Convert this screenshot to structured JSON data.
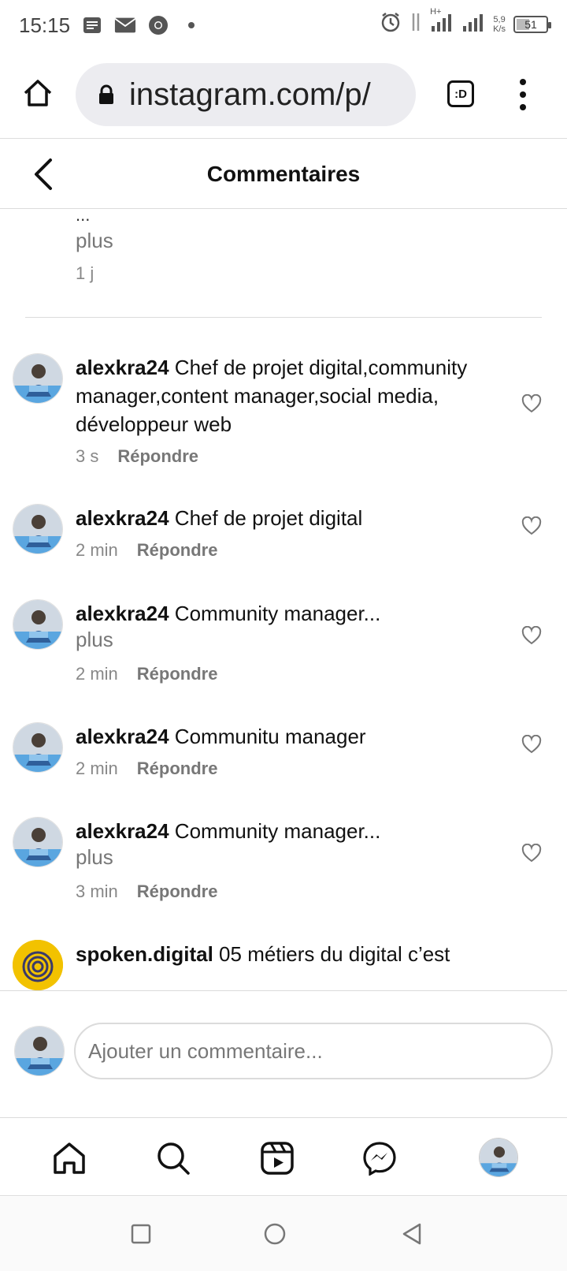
{
  "status_bar": {
    "time": "15:15",
    "net_speed_value": "5,9",
    "net_speed_unit": "K/s",
    "network_type": "H+",
    "battery": "51",
    "left_icons": [
      "notes-icon",
      "mail-icon",
      "chrome-icon",
      "dot-icon"
    ],
    "right_icons": [
      "alarm-icon",
      "data-arrows-icon",
      "signal-icon",
      "signal-icon"
    ]
  },
  "browser": {
    "url": "instagram.com/p/",
    "tab_icon_label": ":D"
  },
  "header": {
    "title": "Commentaires"
  },
  "previous_comment": {
    "ellipsis": "...",
    "more": "plus",
    "time": "1 j"
  },
  "comments": [
    {
      "user": "alexkra24",
      "text": "Chef de projet digital,community manager,content manager,social media, développeur web",
      "time": "3 s",
      "reply": "Répondre"
    },
    {
      "user": "alexkra24",
      "text": "Chef de projet digital",
      "time": "2 min",
      "reply": "Répondre"
    },
    {
      "user": "alexkra24",
      "text": "Community manager...",
      "more": "plus",
      "time": "2 min",
      "reply": "Répondre"
    },
    {
      "user": "alexkra24",
      "text": "Communitu manager",
      "time": "2 min",
      "reply": "Répondre"
    },
    {
      "user": "alexkra24",
      "text": "Community manager...",
      "more": "plus",
      "time": "3 min",
      "reply": "Répondre"
    },
    {
      "user": "spoken.digital",
      "text": "05 métiers du digital c’est"
    }
  ],
  "add_comment": {
    "placeholder": "Ajouter un commentaire..."
  },
  "bottom_nav": [
    "home-icon",
    "search-icon",
    "reels-icon",
    "messenger-icon",
    "profile-avatar"
  ],
  "system_nav": [
    "recents-button",
    "home-button",
    "back-button"
  ],
  "colors": {
    "text": "#111111",
    "muted": "#777777",
    "divider": "#dbdbdb",
    "urlbar_bg": "#ececf0",
    "spoken_avatar": "#f2c200"
  }
}
